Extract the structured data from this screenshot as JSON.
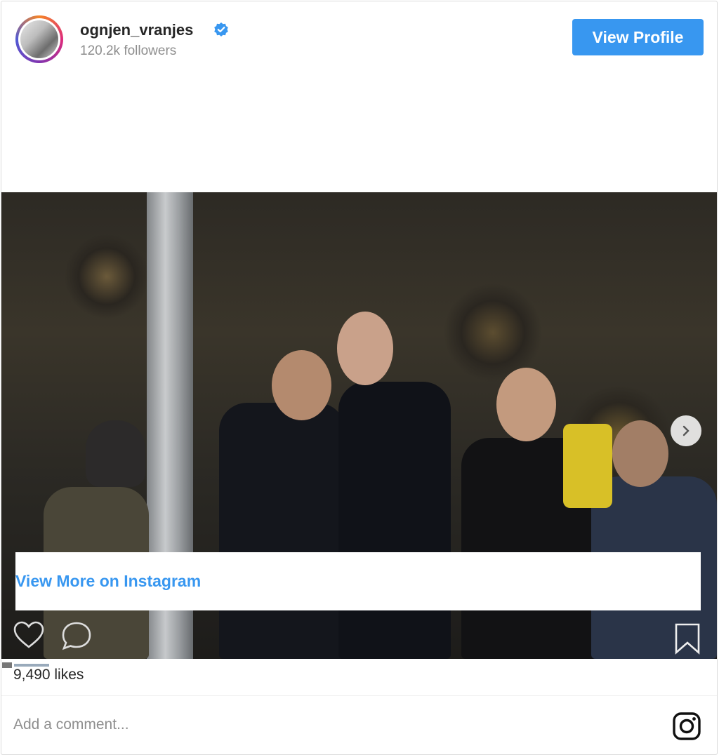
{
  "profile": {
    "username": "ognjen_vranjes",
    "followers": "120.2k followers",
    "verified": true,
    "view_profile_label": "View Profile"
  },
  "post": {
    "view_more_label": "View More on Instagram",
    "likes": "9,490 likes",
    "comment_placeholder": "Add a comment..."
  },
  "colors": {
    "accent": "#3897f0",
    "text": "#262626",
    "muted": "#8e8e8e"
  },
  "icons": [
    "verified-badge-icon",
    "next-arrow-icon",
    "heart-icon",
    "comment-icon",
    "bookmark-icon",
    "instagram-icon"
  ]
}
